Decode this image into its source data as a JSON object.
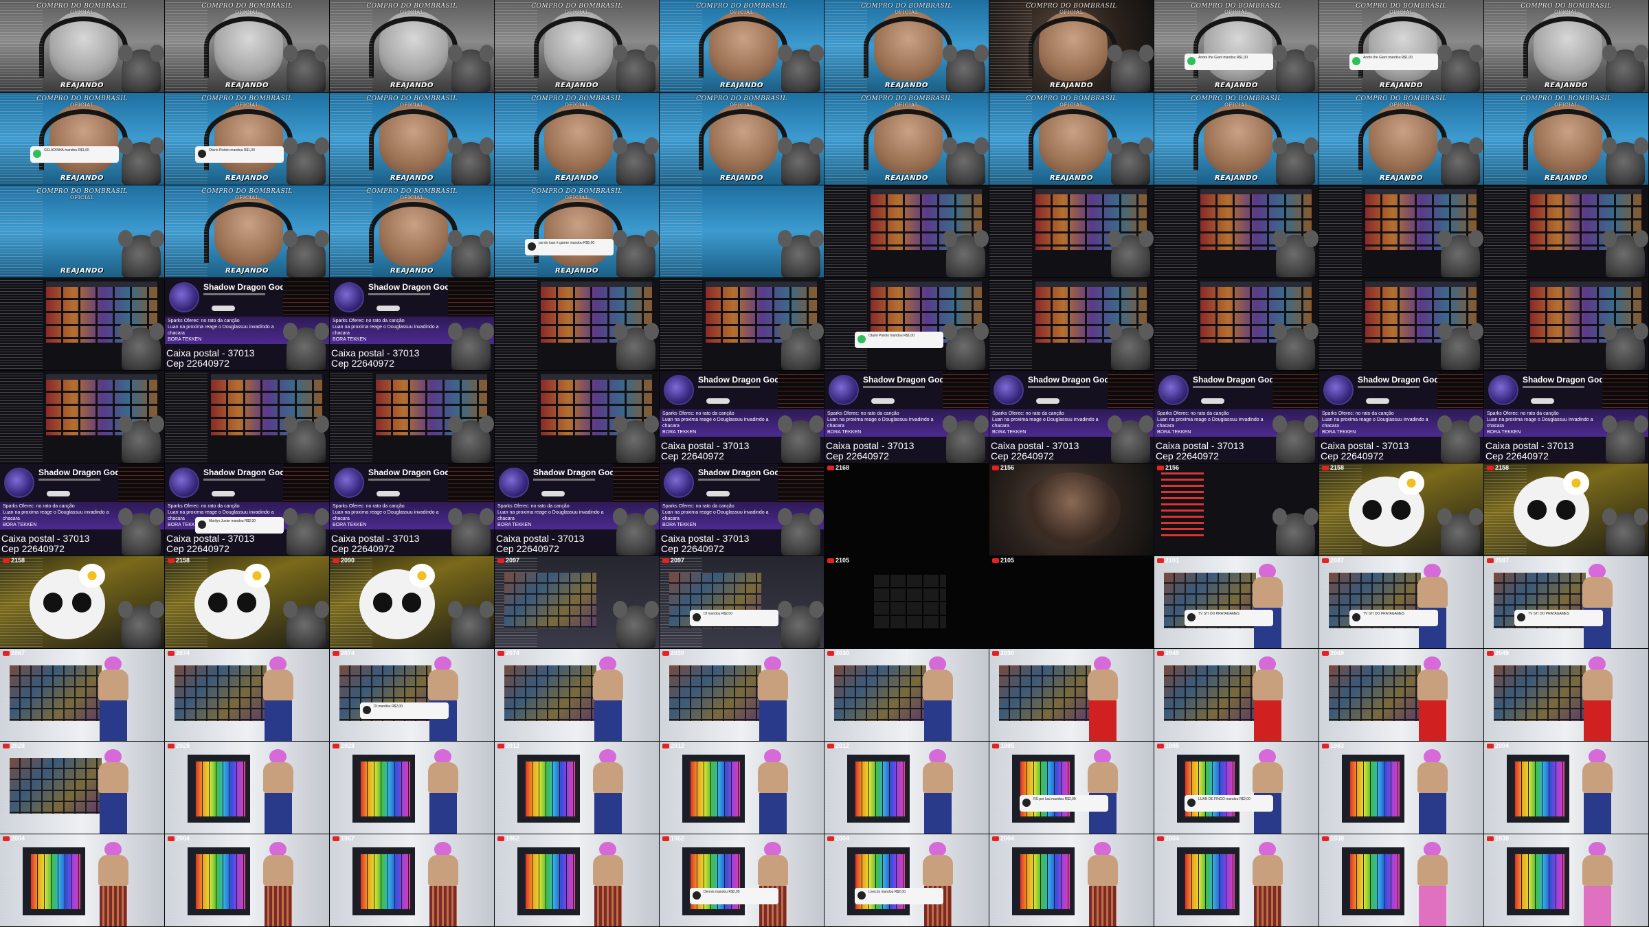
{
  "overlay": {
    "watermark_line1": "COMPRO DO BOMBRASIL",
    "watermark_line2": "OFICIAL",
    "reacting_label": "REAJANDO"
  },
  "channel": {
    "name": "Shadow Dragon God",
    "postal_line1": "Caixa postal - 37013",
    "postal_line2": "Cep 22640972",
    "chat_lines": [
      "Sparks Oferec: no rato da canção",
      "Luan na proxima reage o Douglassuu invadindo a",
      "chacara",
      "BORA TEKKEN"
    ]
  },
  "viewer_counts": {
    "r6": [
      "",
      "",
      "",
      "",
      "",
      "2168",
      "2156",
      "2156",
      "2158",
      "2158"
    ],
    "r7": [
      "2158",
      "2158",
      "2090",
      "2097",
      "2097",
      "2105",
      "2105",
      "2101",
      "2087",
      "2087"
    ],
    "r8": [
      "2067",
      "2074",
      "2074",
      "2074",
      "2030",
      "2030",
      "2030",
      "2049",
      "2049",
      "2049"
    ],
    "r9": [
      "2028",
      "2028",
      "2028",
      "2012",
      "2012",
      "2012",
      "1985",
      "1985",
      "1983",
      "2004"
    ],
    "r10": [
      "2004",
      "2004",
      "1967",
      "1962",
      "1962",
      "2004",
      "2004",
      "2004",
      "1938",
      "1938"
    ]
  },
  "toasts": {
    "geladinha": "GELADINHA mandou R$1,00",
    "andre": "Andre the Giant mandou R$1,00",
    "marilyn": "Marilyn Junior mandou R$2,00",
    "dl": "DI mandou R$2,00",
    "tv": "TV STI DO PRATAGAMES",
    "dennis": "Dennis mandou R$2,00",
    "livecris": "Livecris mandou R$2,00",
    "rs": "RS por luai mandou R$2,00",
    "deumio": "LUAN DE FINGO mandou R$2,00",
    "pai": "pai do luan é gamer mandou R$5,00",
    "otario": "Otario Pistolo mandou R$1,00"
  },
  "colors": {
    "youtube_red": "#e52222",
    "toast_green": "#2fbf5a",
    "chat_purple": "#4c2a90"
  },
  "icons": [
    "youtube-live-icon",
    "pix-toast-icon",
    "rat-mascot-icon",
    "channel-avatar-icon"
  ]
}
